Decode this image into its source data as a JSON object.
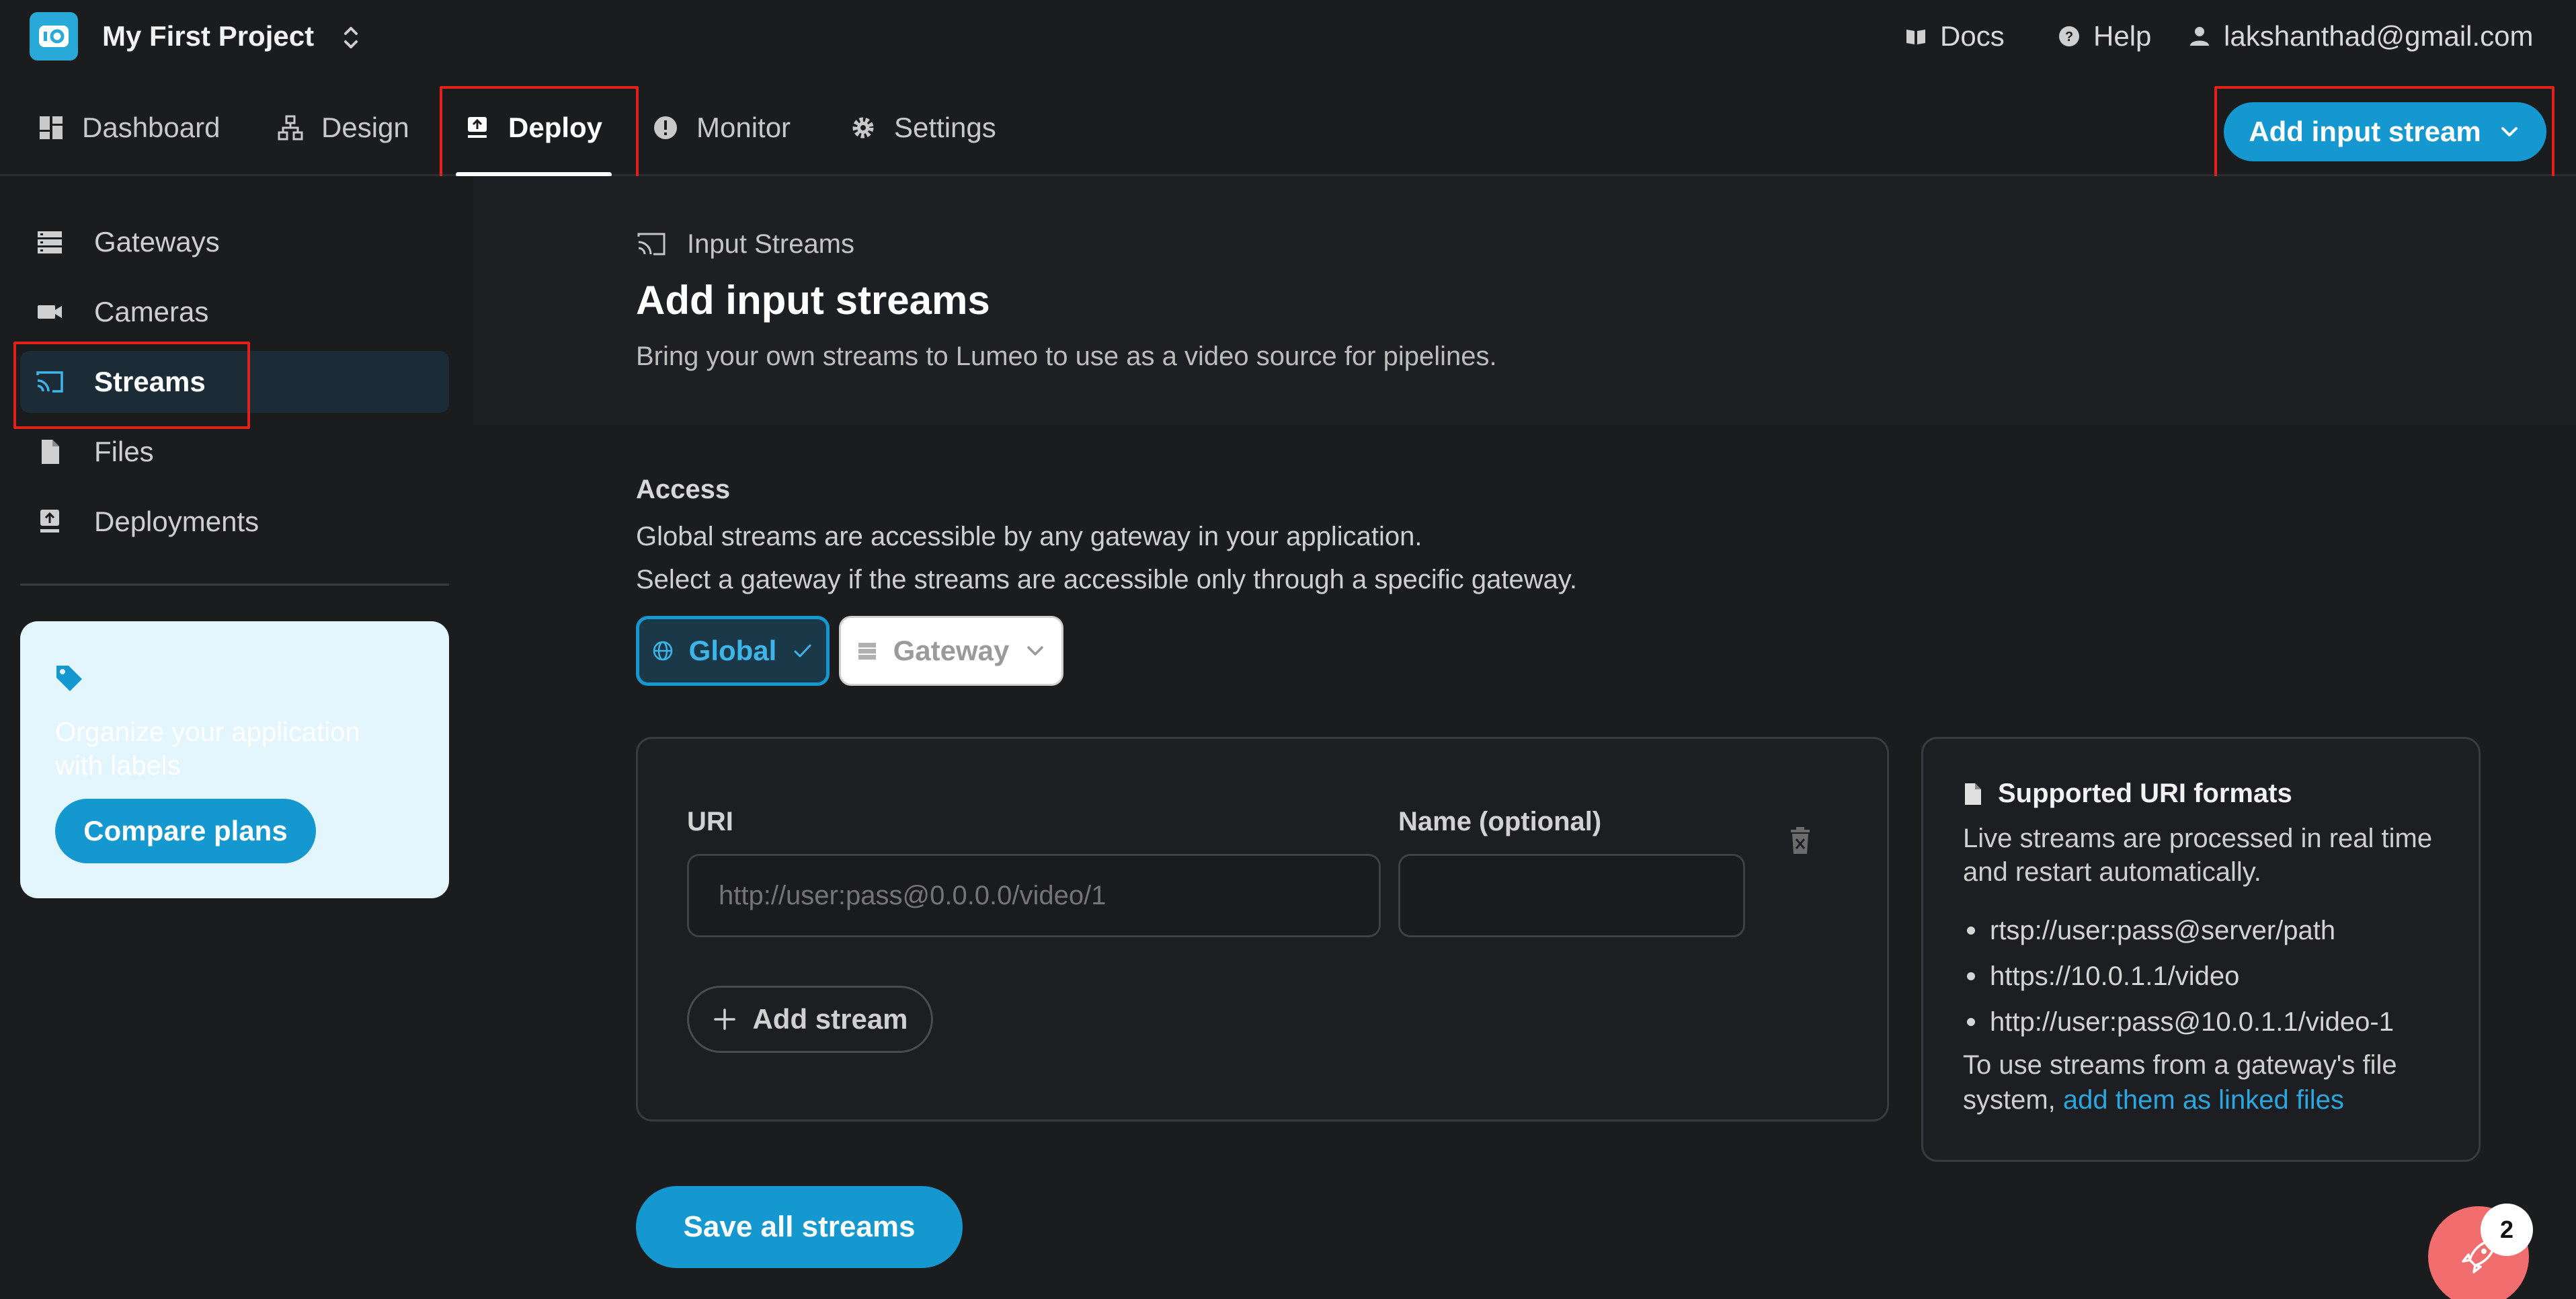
{
  "header": {
    "project_name": "My First Project",
    "links": {
      "docs": "Docs",
      "help": "Help",
      "account": "lakshanthad@gmail.com"
    }
  },
  "nav": {
    "tabs": [
      {
        "label": "Dashboard",
        "icon": "dashboard-icon"
      },
      {
        "label": "Design",
        "icon": "sitemap-icon"
      },
      {
        "label": "Deploy",
        "icon": "deploy-icon",
        "active": true
      },
      {
        "label": "Monitor",
        "icon": "alert-circle-icon"
      },
      {
        "label": "Settings",
        "icon": "gear-icon"
      }
    ],
    "add_input_stream": "Add input stream"
  },
  "sidebar": {
    "items": [
      {
        "label": "Gateways",
        "icon": "server-icon"
      },
      {
        "label": "Cameras",
        "icon": "video-camera-icon"
      },
      {
        "label": "Streams",
        "icon": "cast-icon",
        "active": true
      },
      {
        "label": "Files",
        "icon": "file-icon"
      },
      {
        "label": "Deployments",
        "icon": "deploy-icon"
      }
    ],
    "promo": {
      "text": "Organize your application with labels",
      "button": "Compare plans"
    }
  },
  "main": {
    "breadcrumb": "Input Streams",
    "title": "Add input streams",
    "subtitle": "Bring your own streams to Lumeo to use as a video source for pipelines.",
    "access": {
      "label": "Access",
      "line1": "Global streams are accessible by any gateway in your application.",
      "line2": "Select a gateway if the streams are accessible only through a specific gateway.",
      "global_label": "Global",
      "gateway_label": "Gateway"
    },
    "stream_form": {
      "uri_label": "URI",
      "uri_placeholder": "http://user:pass@0.0.0.0/video/1",
      "name_label": "Name (optional)",
      "name_value": "",
      "add_stream": "Add stream"
    },
    "uri_formats": {
      "title": "Supported URI formats",
      "description": "Live streams are processed in real time and restart automatically.",
      "examples": [
        "rtsp://user:pass@server/path",
        "https://10.0.1.1/video",
        "http://user:pass@10.0.1.1/video-1"
      ],
      "footer_prefix": "To use streams from a gateway's file system,",
      "footer_link": "add them as linked files"
    },
    "save_button": "Save all streams"
  },
  "help_widget": {
    "badge_count": "2"
  },
  "colors": {
    "accent": "#1597cf",
    "highlight": "#e0221b",
    "background": "#1b1c1e"
  }
}
